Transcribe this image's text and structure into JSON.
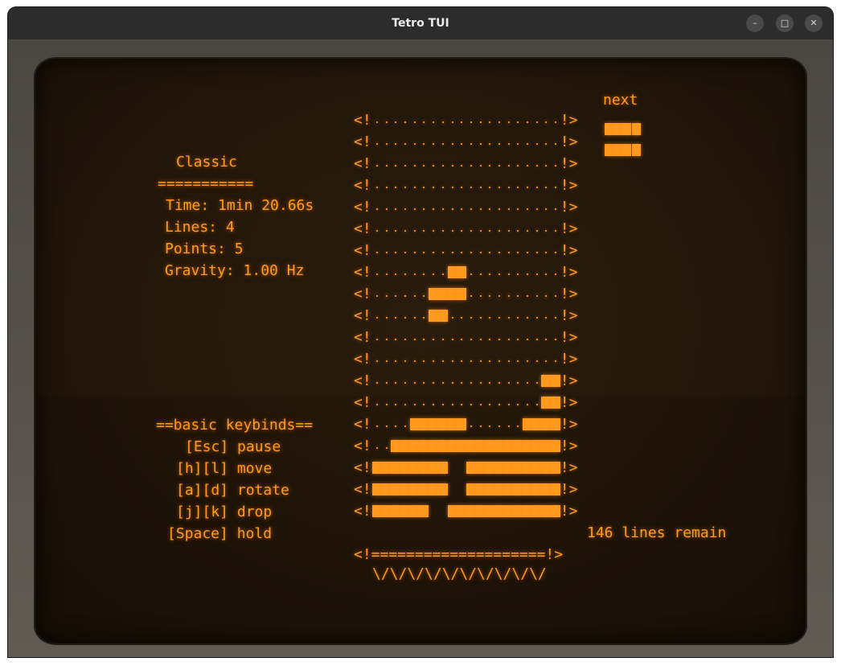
{
  "window": {
    "title": "Tetro TUI"
  },
  "controls": {
    "minimize": "–",
    "maximize": "□",
    "close": "✕"
  },
  "stats": {
    "mode": "Classic",
    "underline": "===========",
    "time": "Time: 1min 20.66s",
    "lines": "Lines: 4",
    "points": "Points: 5",
    "gravity": "Gravity: 1.00 Hz"
  },
  "keybinds": {
    "header": "==basic keybinds==",
    "items": [
      "[Esc] pause",
      "[h][l] move",
      "[a][d] rotate",
      "[j][k] drop",
      "[Space] hold"
    ]
  },
  "next": {
    "label": "next",
    "piece": [
      "####",
      "####"
    ]
  },
  "board": {
    "left_wall": "<!",
    "right_wall": "!>",
    "floor": "<!====================!>",
    "base": "\\/\\/\\/\\/\\/\\/\\/\\/\\/\\/",
    "rows": [
      "....................",
      "....................",
      "....................",
      "....................",
      "....................",
      "....................",
      "....................",
      "........##..........",
      "......####..........",
      "......##............",
      "....................",
      "....................",
      "..................##",
      "..................##",
      "....######......####",
      "..##################",
      "########  ##########",
      "########  ##########",
      "######  ############"
    ]
  },
  "remaining": "146 lines remain"
}
